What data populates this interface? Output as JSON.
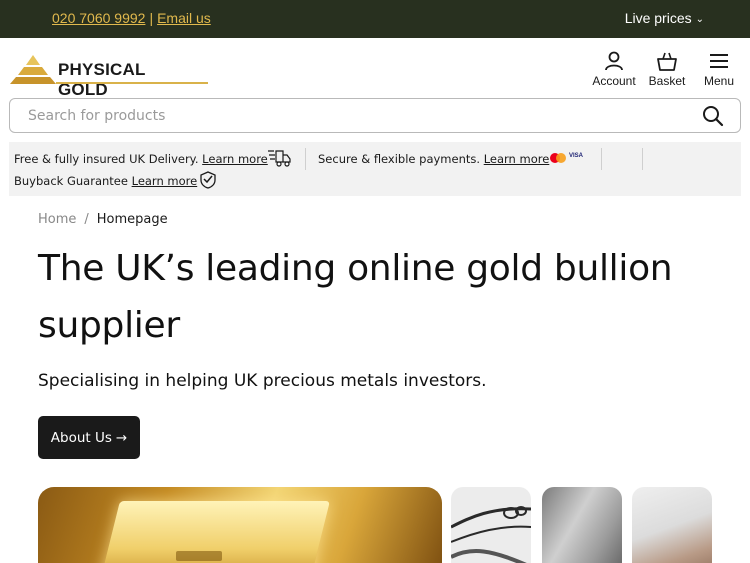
{
  "topbar": {
    "phone": "020 7060 9992",
    "separator": "|",
    "email_label": "Email us",
    "live_prices_label": "Live prices"
  },
  "header": {
    "logo_text": "PHYSICAL GOLD",
    "nav": {
      "account_label": "Account",
      "basket_label": "Basket",
      "menu_label": "Menu"
    }
  },
  "search": {
    "placeholder": "Search for products",
    "value": ""
  },
  "usp": {
    "delivery_text": "Free & fully insured UK Delivery.",
    "delivery_link": "Learn more",
    "payments_text": "Secure & flexible payments.",
    "payments_link": "Learn more",
    "visa_text": "VISA",
    "buyback_text": "Buyback Guarantee",
    "buyback_link": "Learn more"
  },
  "breadcrumb": {
    "home": "Home",
    "separator": "/",
    "current": "Homepage"
  },
  "hero": {
    "title": "The UK’s leading online gold bullion supplier",
    "subtitle": "Specialising in helping UK precious metals investors.",
    "about_button": "About Us"
  },
  "colors": {
    "topbar_bg": "#28301f",
    "accent_gold": "#e1b94d",
    "button_dark": "#1a1a1a",
    "usp_bg": "#f2f2f2"
  },
  "icons": [
    "user-icon",
    "basket-icon",
    "hamburger-icon",
    "search-icon",
    "delivery-truck-icon",
    "mastercard-icon",
    "visa-icon",
    "shield-check-icon",
    "arrow-right-icon",
    "chevron-down-icon"
  ]
}
